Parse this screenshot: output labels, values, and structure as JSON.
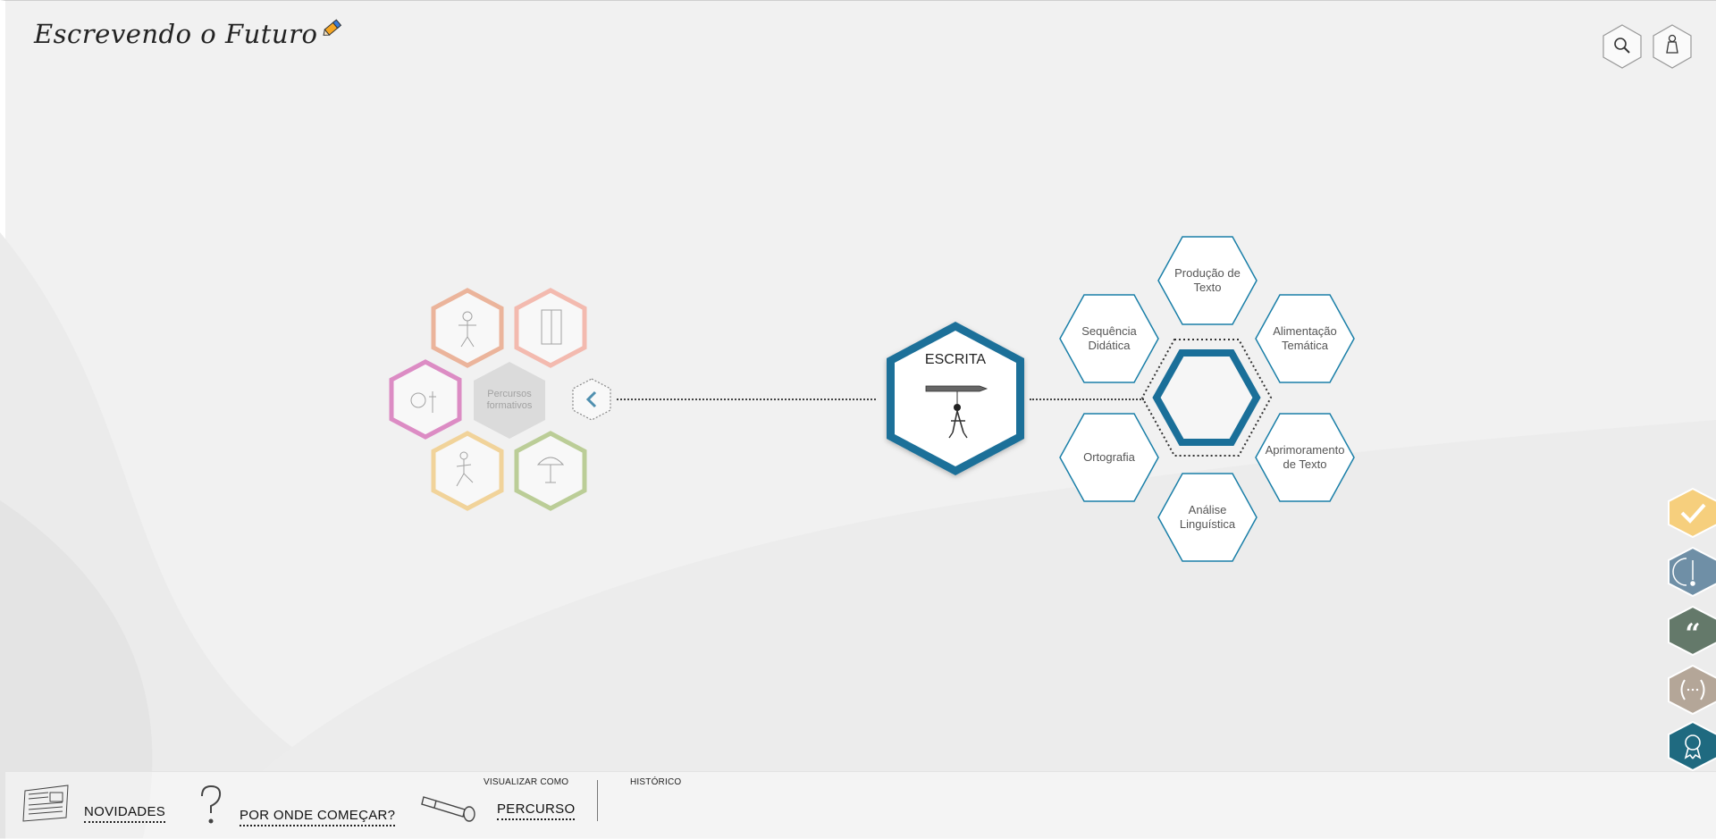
{
  "logo": {
    "text": "Escrevendo o Futuro"
  },
  "header": {
    "search_icon": "search-icon",
    "user_icon": "user-icon"
  },
  "percursos": {
    "center_label": "Percursos\nformativos",
    "petals": [
      {
        "name": "percurso-orange",
        "color": "#e9a07f"
      },
      {
        "name": "percurso-salmon",
        "color": "#f4a89a"
      },
      {
        "name": "percurso-magenta",
        "color": "#d66bb6"
      },
      {
        "name": "percurso-yellow",
        "color": "#f2c97d"
      },
      {
        "name": "percurso-green",
        "color": "#a9c27a"
      }
    ],
    "collapse_icon": "chevron-left-icon"
  },
  "main_node": {
    "title": "ESCRITA",
    "color": "#1a6f99"
  },
  "sub_nodes": [
    {
      "label": "Produção de\nTexto"
    },
    {
      "label": "Sequência\nDidática"
    },
    {
      "label": "Alimentação\nTemática"
    },
    {
      "label": "Ortografia"
    },
    {
      "label": "Aprimoramento\nde Texto"
    },
    {
      "label": "Análise\nLinguística"
    }
  ],
  "side_icons": [
    {
      "name": "check-icon",
      "color": "#f6cf7d"
    },
    {
      "name": "pencil-tip-icon",
      "color": "#6f8fa6"
    },
    {
      "name": "quote-icon",
      "color": "#64796a"
    },
    {
      "name": "parentheses-icon",
      "color": "#b4a698"
    },
    {
      "name": "award-icon",
      "color": "#1f6a80"
    }
  ],
  "bottom_bar": {
    "novidades": "NOVIDADES",
    "por_onde": "POR ONDE COMEÇAR?",
    "visualizar_como": "VISUALIZAR COMO",
    "percurso": "PERCURSO",
    "historico": "HISTÓRICO"
  },
  "colors": {
    "teal": "#1a7fa8",
    "dark_blue": "#14628a"
  }
}
